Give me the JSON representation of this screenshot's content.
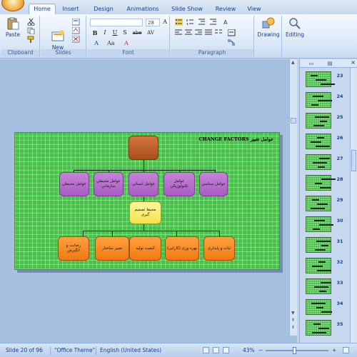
{
  "tabs": [
    {
      "label": "Home",
      "active": true
    },
    {
      "label": "Insert"
    },
    {
      "label": "Design"
    },
    {
      "label": "Animations"
    },
    {
      "label": "Slide Show"
    },
    {
      "label": "Review"
    },
    {
      "label": "View"
    }
  ],
  "ribbon": {
    "clipboard": {
      "paste_label": "Paste",
      "group_label": "Clipboard"
    },
    "slides": {
      "new_slide_label": "New\nSlide",
      "group_label": "Slides"
    },
    "font": {
      "font_name": "",
      "font_size": "28",
      "group_label": "Font",
      "buttons": [
        "B",
        "I",
        "U",
        "S",
        "abe",
        "AV"
      ]
    },
    "paragraph": {
      "group_label": "Paragraph"
    },
    "drawing": {
      "label": "Drawing"
    },
    "editing": {
      "label": "Editing"
    }
  },
  "slide": {
    "title": "CHANGE FACTORS عوامل تغيير",
    "top_box": "",
    "purple_boxes": [
      "عوامل محيطي",
      "عوامل محيطي سازماني",
      "عوامل انساني",
      "عوامل تکنولوژيكي",
      "عوامل سياسي"
    ],
    "middle_box": "محیط تصمیم گیری",
    "orange_boxes": [
      "رضایت و انگیزش",
      "تغییر ساختار",
      "کیفیت تولید",
      "بهره وری (کارایی)",
      "ثبات و پایداری"
    ]
  },
  "thumbnails_panel": {
    "tab_labels": [
      "Outline",
      "Slides"
    ],
    "close_glyph": "×",
    "numbers": [
      "23",
      "24",
      "25",
      "26",
      "27",
      "28",
      "29",
      "30",
      "31",
      "32",
      "33",
      "34",
      "35"
    ]
  },
  "status_bar": {
    "slide_counter": "Slide 20 of 96",
    "theme": "\"Office Theme\"",
    "language": "English (United States)",
    "zoom": "43%"
  },
  "colors": {
    "ribbon_bg": "#dbe7f6",
    "slide_green": "#45c447",
    "box_purple": "#b46dcc",
    "box_orange": "#f7891f",
    "box_yellow": "#fbed6c",
    "box_brown": "#bd6128"
  }
}
